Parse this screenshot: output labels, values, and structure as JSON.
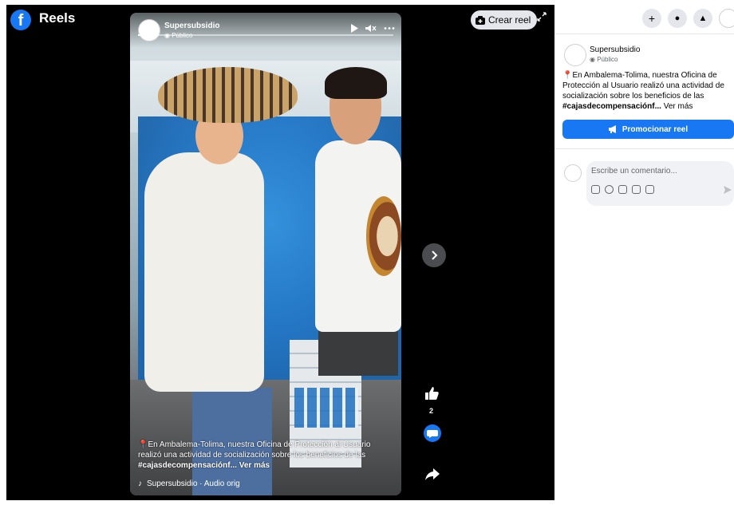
{
  "header": {
    "logo_letter": "f",
    "title": "Reels",
    "create_reel": "Crear reel"
  },
  "video": {
    "page_name": "Supersubsidio",
    "privacy": "Público",
    "caption_text": "En Ambalema-Tolima, nuestra Oficina de Protección al Usuario realizó una actividad de socialización sobre los beneficios de las",
    "caption_hashtag": "#cajasdecompensaciónf...",
    "caption_more": "Ver más",
    "audio": "Supersubsidio · Audio orig",
    "progress": 0.02
  },
  "actions": {
    "like_count": "2"
  },
  "panel": {
    "page_name": "Supersubsidio",
    "privacy": "Público",
    "text": "En Ambalema-Tolima, nuestra Oficina de Protección al Usuario realizó una actividad de socialización sobre los beneficios de las",
    "hashtag": "#cajasdecompensaciónf...",
    "more": "Ver más",
    "promote_label": "Promocionar reel",
    "comment_placeholder": "Escribe un comentario..."
  },
  "colors": {
    "brand": "#1877f2",
    "stage": "#000000",
    "pill": "#e4e6eb"
  }
}
